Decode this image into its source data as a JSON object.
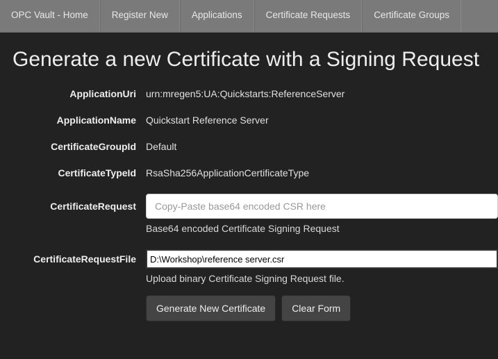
{
  "nav": {
    "items": [
      {
        "label": "OPC Vault - Home"
      },
      {
        "label": "Register New"
      },
      {
        "label": "Applications"
      },
      {
        "label": "Certificate Requests"
      },
      {
        "label": "Certificate Groups"
      }
    ]
  },
  "page": {
    "title": "Generate a new Certificate with a Signing Request"
  },
  "form": {
    "applicationUri": {
      "label": "ApplicationUri",
      "value": "urn:mregen5:UA:Quickstarts:ReferenceServer"
    },
    "applicationName": {
      "label": "ApplicationName",
      "value": "Quickstart Reference Server"
    },
    "certificateGroupId": {
      "label": "CertificateGroupId",
      "value": "Default"
    },
    "certificateTypeId": {
      "label": "CertificateTypeId",
      "value": "RsaSha256ApplicationCertificateType"
    },
    "certificateRequest": {
      "label": "CertificateRequest",
      "placeholder": "Copy-Paste base64 encoded CSR here",
      "help": "Base64 encoded Certificate Signing Request"
    },
    "certificateRequestFile": {
      "label": "CertificateRequestFile",
      "value": "D:\\Workshop\\reference server.csr",
      "help": "Upload binary Certificate Signing Request file."
    },
    "buttons": {
      "generate": "Generate New Certificate",
      "clear": "Clear Form"
    }
  }
}
